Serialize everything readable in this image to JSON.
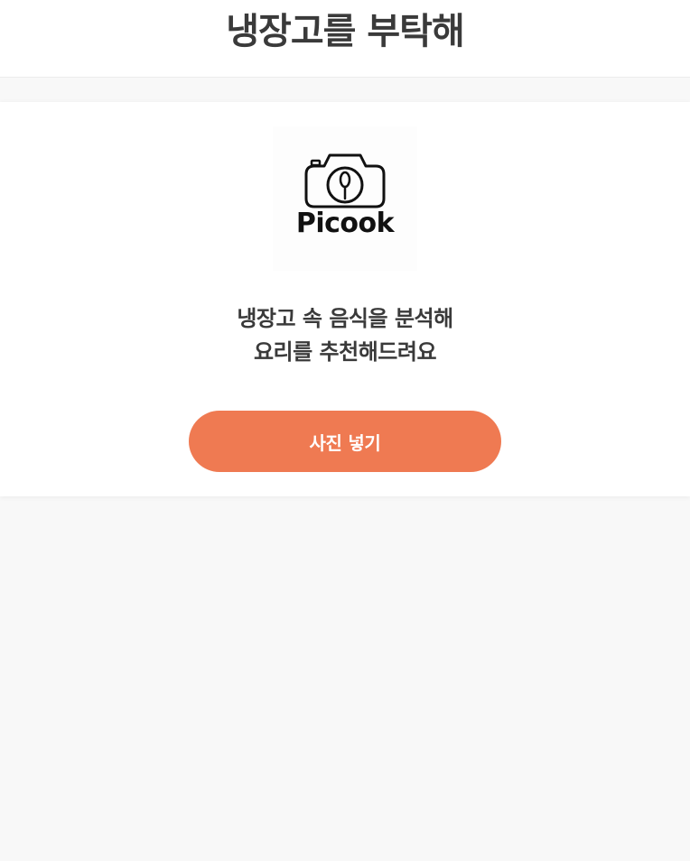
{
  "header": {
    "title": "냉장고를 부탁해"
  },
  "card": {
    "logo": {
      "icon": "camera-spoon-icon",
      "text": "Picook"
    },
    "description": {
      "line1": "냉장고 속 음식을 분석해",
      "line2": "요리를 추천해드려요"
    },
    "cta_label": "사진 넣기"
  },
  "colors": {
    "accent": "#ef7a52",
    "title_text": "#3a3a3a",
    "background": "#f8f8f8",
    "card": "#ffffff"
  }
}
